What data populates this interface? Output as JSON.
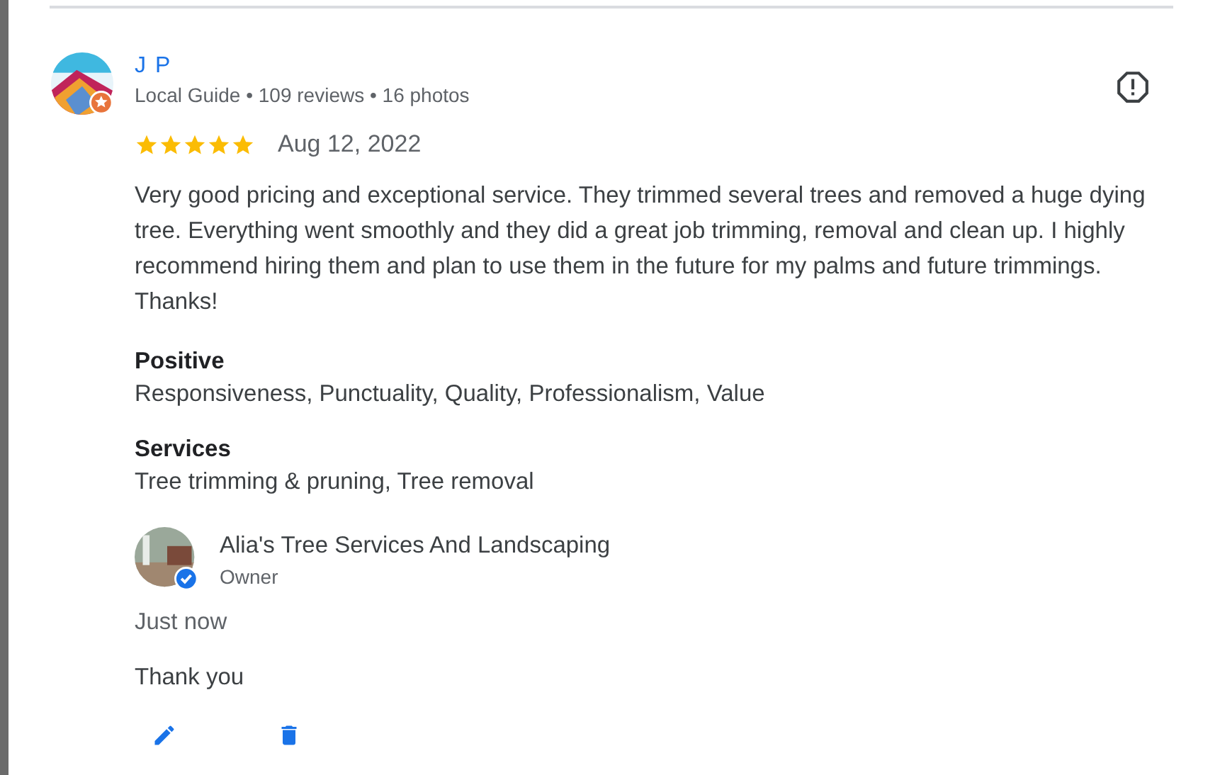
{
  "review": {
    "author": "J P",
    "meta": "Local Guide • 109 reviews • 16 photos",
    "stars": 5,
    "date": "Aug 12, 2022",
    "text": "Very good pricing and exceptional service. They trimmed several trees and removed a huge dying tree. Everything went smoothly and they did a great job trimming, removal and clean up. I highly recommend hiring them and plan to use them in the future for my palms and future trimmings. Thanks!",
    "sections": [
      {
        "heading": "Positive",
        "value": "Responsiveness, Punctuality, Quality, Professionalism, Value"
      },
      {
        "heading": "Services",
        "value": "Tree trimming & pruning, Tree removal"
      }
    ]
  },
  "owner_reply": {
    "name": "Alia's Tree Services And Landscaping",
    "role": "Owner",
    "time": "Just now",
    "text": "Thank you"
  }
}
